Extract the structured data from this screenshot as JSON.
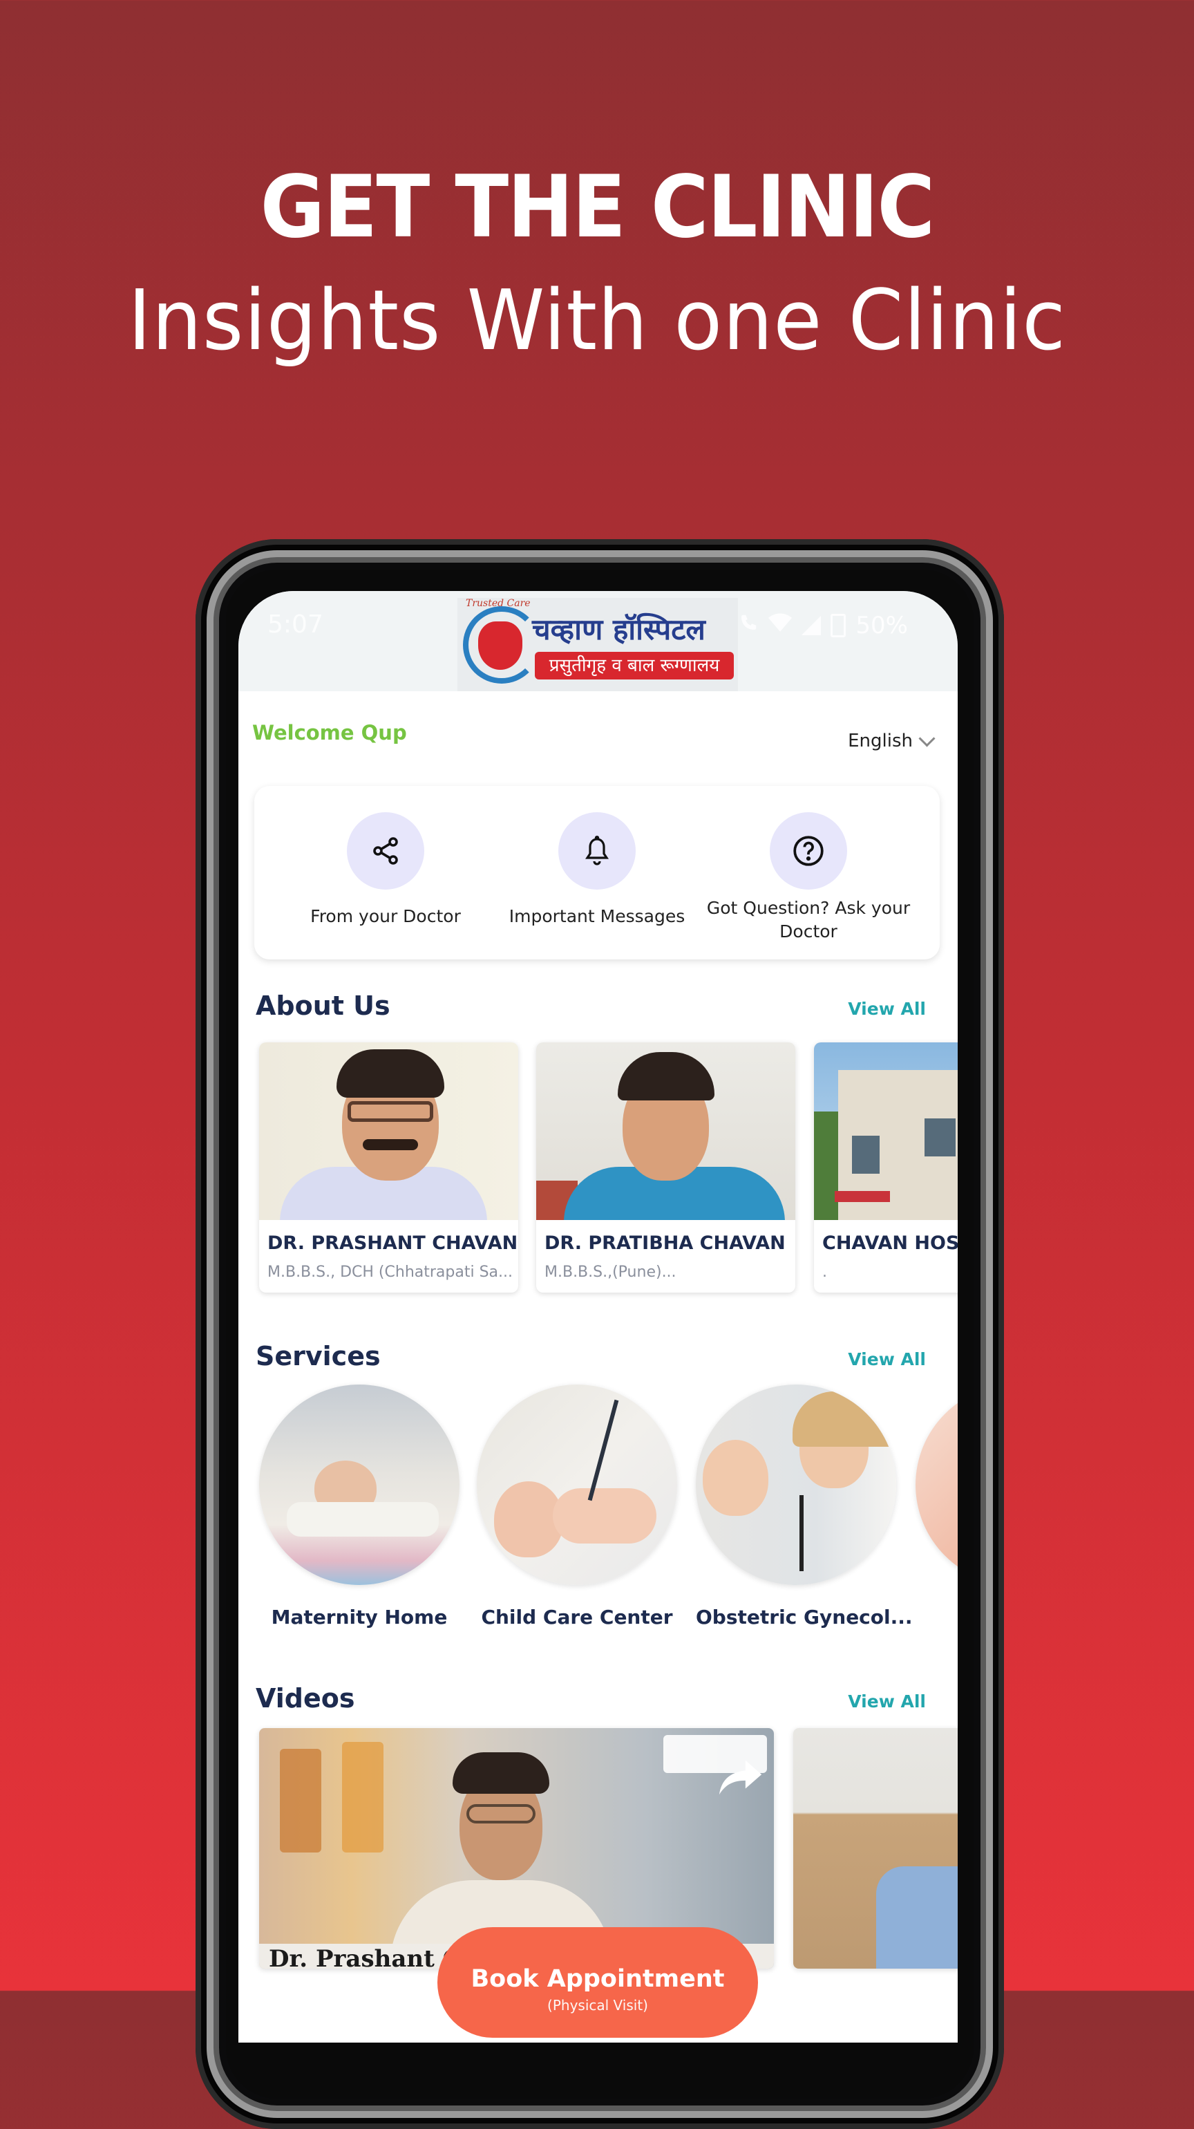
{
  "promo": {
    "headline": "GET THE CLINIC",
    "subheadline": "Insights With one Clinic"
  },
  "status_bar": {
    "time": "5:07",
    "battery": "50%",
    "icons": [
      "call-icon",
      "wifi-icon",
      "signal-icon",
      "battery-icon"
    ]
  },
  "app_header": {
    "logo_title": "चव्हाण हॉस्पिटल",
    "logo_subtitle": "प्रसुतीगृह व बाल रूग्णालय",
    "logo_tagline": "Trusted Care"
  },
  "welcome": {
    "text": "Welcome Qup"
  },
  "language": {
    "selected": "English"
  },
  "quick_actions": [
    {
      "label": "From your Doctor",
      "icon": "share-icon"
    },
    {
      "label": "Important Messages",
      "icon": "bell-icon"
    },
    {
      "label": "Got Question? Ask your Doctor",
      "icon": "question-icon"
    }
  ],
  "sections": {
    "about": {
      "title": "About Us",
      "view_all": "View All"
    },
    "services": {
      "title": "Services",
      "view_all": "View All"
    },
    "videos": {
      "title": "Videos",
      "view_all": "View All"
    }
  },
  "about_cards": [
    {
      "name": "DR. PRASHANT CHAVAN",
      "subtitle": "M.B.B.S., DCH (Chhatrapati Sa..."
    },
    {
      "name": "DR. PRATIBHA CHAVAN",
      "subtitle": "M.B.B.S.,(Pune)..."
    },
    {
      "name": "CHAVAN HOSP",
      "subtitle": "."
    }
  ],
  "services": [
    {
      "label": "Maternity Home"
    },
    {
      "label": "Child Care Center"
    },
    {
      "label": "Obstetric Gynecol..."
    },
    {
      "label": ""
    }
  ],
  "videos": [
    {
      "caption": "Dr. Prashant Ch"
    },
    {
      "caption": ""
    }
  ],
  "book_appointment": {
    "label": "Book Appointment",
    "sublabel": "(Physical Visit)",
    "color": "#f6664a"
  },
  "colors": {
    "welcome": "#76c442",
    "view_all": "#23a6ad",
    "heading": "#1d2b4f",
    "icon_bg": "#e7e6fb"
  }
}
